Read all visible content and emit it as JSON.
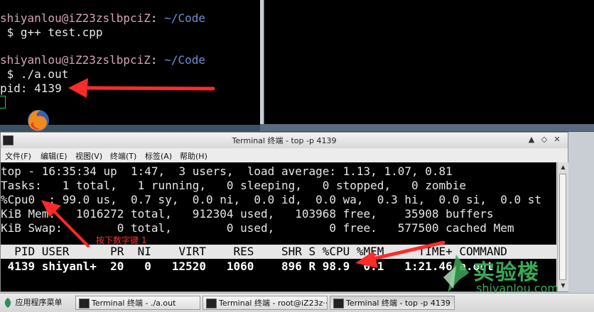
{
  "term1": {
    "lines": [
      {
        "user": "shiyanlou@iZ23zslbpciZ",
        "sep": ":",
        "path": " ~/Code"
      },
      {
        "text": " $ g++ test.cpp"
      },
      {
        "user": "shiyanlou@iZ23zslbpciZ",
        "sep": ":",
        "path": " ~/Code"
      },
      {
        "text": " $ ./a.out"
      },
      {
        "text": "pid: 4139"
      }
    ]
  },
  "window": {
    "title": "Terminal 终端 - top -p 4139",
    "menu": [
      "文件(F)",
      "编辑(E)",
      "视图(V)",
      "终端(T)",
      "标签(A)",
      "帮助(H)"
    ]
  },
  "top": {
    "line1": "top - 16:35:34 up  1:47,  3 users,  load average: 1.13, 1.07, 0.81",
    "line2": "Tasks:   1 total,   1 running,   0 sleeping,   0 stopped,   0 zombie",
    "line3": "%Cpu0  : 99.0 us,  0.7 sy,  0.0 ni,  0.0 id,  0.0 wa,  0.3 hi,  0.0 si,  0.0 st",
    "line4": "KiB Mem:   1016272 total,   912304 used,   103968 free,    35908 buffers",
    "line5": "KiB Swap:        0 total,        0 used,        0 free.   577500 cached Mem",
    "header": "  PID USER      PR  NI    VIRT    RES    SHR S %CPU %MEM     TIME+ COMMAND",
    "process": " 4139 shiyanl+  20   0   12520   1060    896 R 98.9  0.1   1:21.46 a.out"
  },
  "annotation": "按下数字键 1",
  "watermark": {
    "cn": "实验楼",
    "en": "shiyanlou.com"
  },
  "taskbar": {
    "start": "应用程序菜单",
    "tasks": [
      "Terminal 终端 - ./a.out",
      "Terminal 终端 - root@iZ23z···",
      "Terminal 终端 - top -p 4139"
    ]
  },
  "colors": {
    "arrow": "#ff2a2a",
    "watermark": "#3aa856"
  }
}
